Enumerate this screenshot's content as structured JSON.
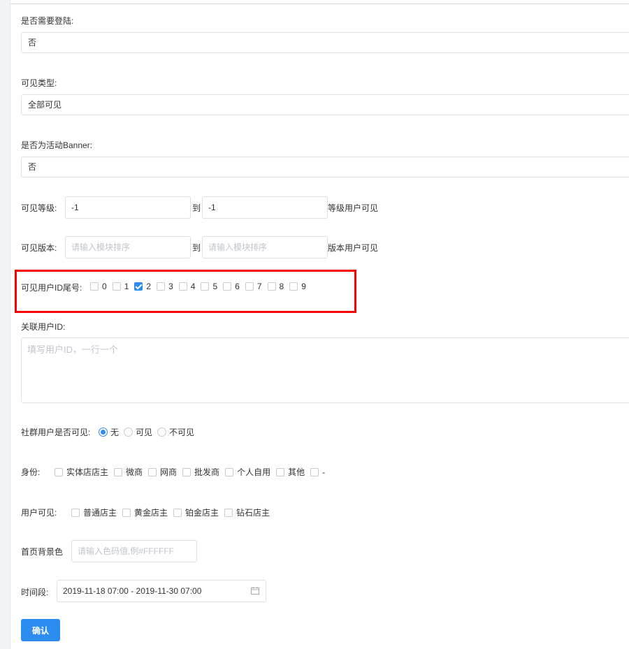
{
  "login": {
    "label": "是否需要登陆:",
    "value": "否"
  },
  "visible_type": {
    "label": "可见类型:",
    "value": "全部可见"
  },
  "activity_banner": {
    "label": "是否为活动Banner:",
    "value": "否"
  },
  "level": {
    "label": "可见等级:",
    "from_value": "-1",
    "to_text": "到",
    "to_value": "-1",
    "suffix": "等级用户可见"
  },
  "version": {
    "label": "可见版本:",
    "from_placeholder": "请输入模块排序",
    "to_text": "到",
    "to_placeholder": "请输入模块排序",
    "suffix": "版本用户可见"
  },
  "id_tail": {
    "label": "可见用户ID尾号:",
    "options": [
      {
        "label": "0",
        "checked": false
      },
      {
        "label": "1",
        "checked": false
      },
      {
        "label": "2",
        "checked": true
      },
      {
        "label": "3",
        "checked": false
      },
      {
        "label": "4",
        "checked": false
      },
      {
        "label": "5",
        "checked": false
      },
      {
        "label": "6",
        "checked": false
      },
      {
        "label": "7",
        "checked": false
      },
      {
        "label": "8",
        "checked": false
      },
      {
        "label": "9",
        "checked": false
      }
    ]
  },
  "related_ids": {
    "label": "关联用户ID:",
    "placeholder": "填写用户ID，一行一个"
  },
  "community": {
    "label": "社群用户是否可见:",
    "options": [
      {
        "label": "无",
        "checked": true
      },
      {
        "label": "可见",
        "checked": false
      },
      {
        "label": "不可见",
        "checked": false
      }
    ]
  },
  "identity": {
    "label": "身份:",
    "options": [
      {
        "label": "实体店店主",
        "checked": false
      },
      {
        "label": "微商",
        "checked": false
      },
      {
        "label": "网商",
        "checked": false
      },
      {
        "label": "批发商",
        "checked": false
      },
      {
        "label": "个人自用",
        "checked": false
      },
      {
        "label": "其他",
        "checked": false
      },
      {
        "label": "-",
        "checked": false
      }
    ]
  },
  "user_visible": {
    "label": "用户可见:",
    "options": [
      {
        "label": "普通店主",
        "checked": false
      },
      {
        "label": "黄金店主",
        "checked": false
      },
      {
        "label": "铂金店主",
        "checked": false
      },
      {
        "label": "钻石店主",
        "checked": false
      }
    ]
  },
  "bg_color": {
    "label": "首页背景色",
    "placeholder": "请输入色码值,例#FFFFFF"
  },
  "time_range": {
    "label": "时间段:",
    "value": "2019-11-18 07:00 - 2019-11-30 07:00"
  },
  "confirm": {
    "label": "确认"
  },
  "colors": {
    "primary": "#2d8cf0",
    "highlight": "#ff0000",
    "border": "#dcdfe6"
  }
}
